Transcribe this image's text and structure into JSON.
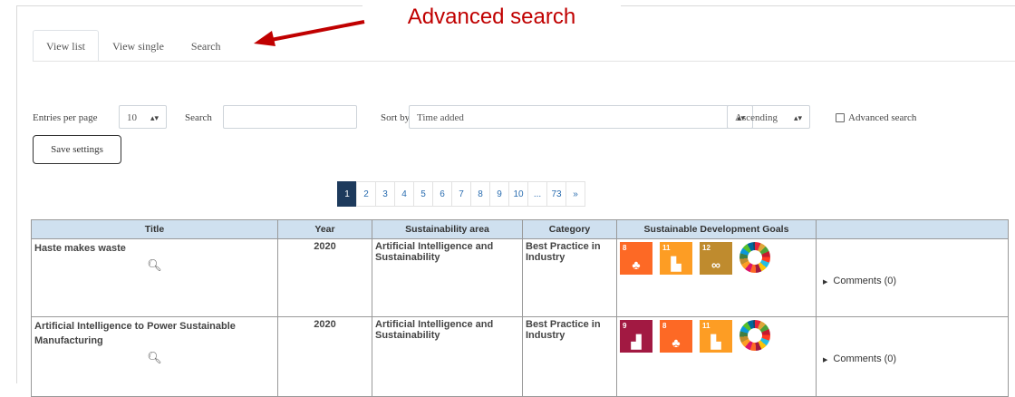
{
  "annotation": {
    "text": "Advanced search",
    "color": "#c00000"
  },
  "tabs": [
    {
      "label": "View list",
      "active": true
    },
    {
      "label": "View single",
      "active": false
    },
    {
      "label": "Search",
      "active": false
    }
  ],
  "controls": {
    "entries_label": "Entries per page",
    "entries_value": "10",
    "search_label": "Search",
    "search_value": "",
    "sort_label": "Sort by",
    "sort_value": "Time added",
    "order_value": "Ascending",
    "advanced_label": "Advanced search",
    "advanced_checked": false,
    "save_label": "Save settings"
  },
  "pagination": [
    "1",
    "2",
    "3",
    "4",
    "5",
    "6",
    "7",
    "8",
    "9",
    "10",
    "...",
    "73",
    "»"
  ],
  "pagination_active": "1",
  "table": {
    "headers": [
      "Title",
      "Year",
      "Sustainability area",
      "Category",
      "Sustainable Development Goals",
      ""
    ],
    "rows": [
      {
        "title": "Haste makes waste",
        "year": "2020",
        "area": "Artificial Intelligence and Sustainability",
        "category": "Best Practice in Industry",
        "sdg_goals": [
          "8",
          "11",
          "12",
          "wheel"
        ],
        "comments": "Comments (0)"
      },
      {
        "title": "Artificial Intelligence to Power Sustainable Manufacturing",
        "year": "2020",
        "area": "Artificial Intelligence and Sustainability",
        "category": "Best Practice in Industry",
        "sdg_goals": [
          "9",
          "8",
          "11",
          "wheel"
        ],
        "comments": "Comments (0)"
      }
    ]
  },
  "icons": {
    "zoom": "magnifier-plus-icon",
    "comments_toggle": "triangle-right-icon"
  },
  "colors": {
    "header_bg": "#cfe0ef",
    "page_active": "#1d3a5c",
    "sdg_8": "#a21942",
    "sdg_9": "#fd6925",
    "sdg_11": "#fd9d24",
    "sdg_12": "#bf8b2e"
  }
}
